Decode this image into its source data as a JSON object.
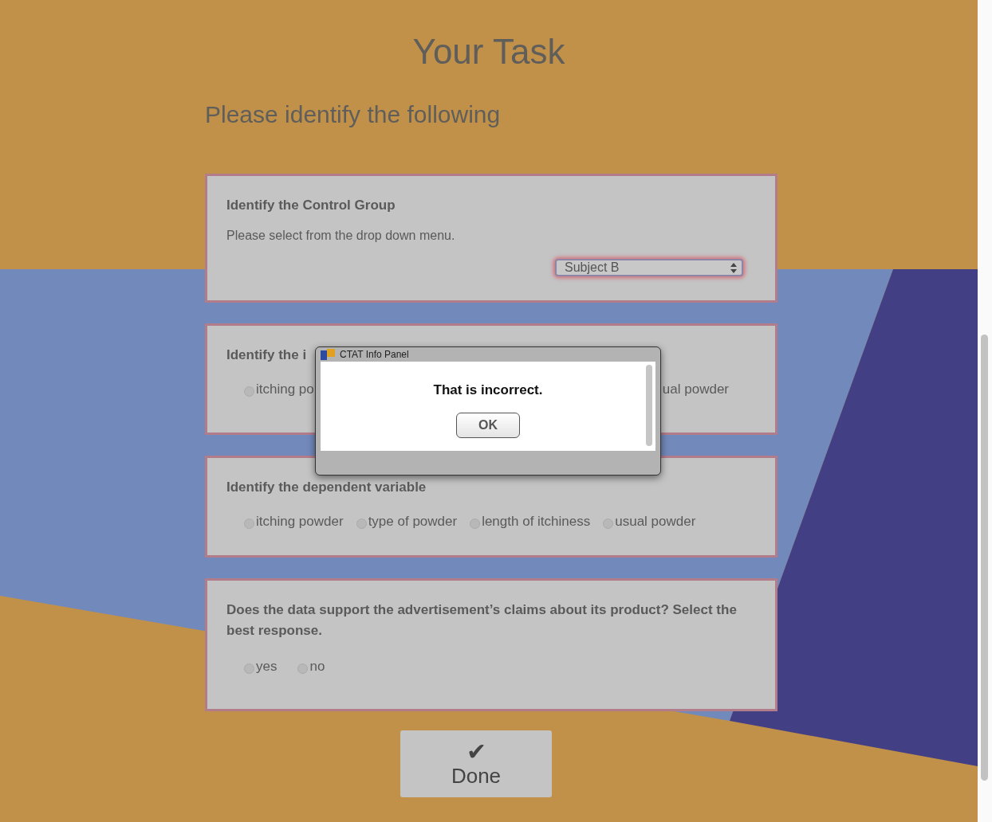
{
  "title": "Your Task",
  "subtitle": "Please identify the following",
  "cards": [
    {
      "kind": "dropdown",
      "heading": "Identify the Control Group",
      "hint": "Please select from the drop down menu.",
      "select": {
        "value": "Subject B"
      }
    },
    {
      "kind": "covered",
      "heading": "Identify the i",
      "options": [
        {
          "label": "itching po",
          "checked": false
        },
        {
          "label": "ual powder"
        }
      ]
    },
    {
      "kind": "radios",
      "heading": "Identify the dependent variable",
      "options": [
        {
          "label": "itching powder",
          "checked": false
        },
        {
          "label": "type of powder",
          "checked": false
        },
        {
          "label": "length of itchiness",
          "checked": false
        },
        {
          "label": "usual powder",
          "checked": false
        }
      ]
    },
    {
      "kind": "radios",
      "heading": "Does the data support the advertisement’s claims about its product? Select the best response.",
      "options": [
        {
          "label": "yes",
          "checked": false
        },
        {
          "label": "no",
          "checked": false
        }
      ]
    }
  ],
  "done_button": {
    "icon": "✔",
    "label": "Done"
  },
  "dialog": {
    "title": "CTAT Info Panel",
    "message": "That is incorrect.",
    "button": "OK"
  }
}
